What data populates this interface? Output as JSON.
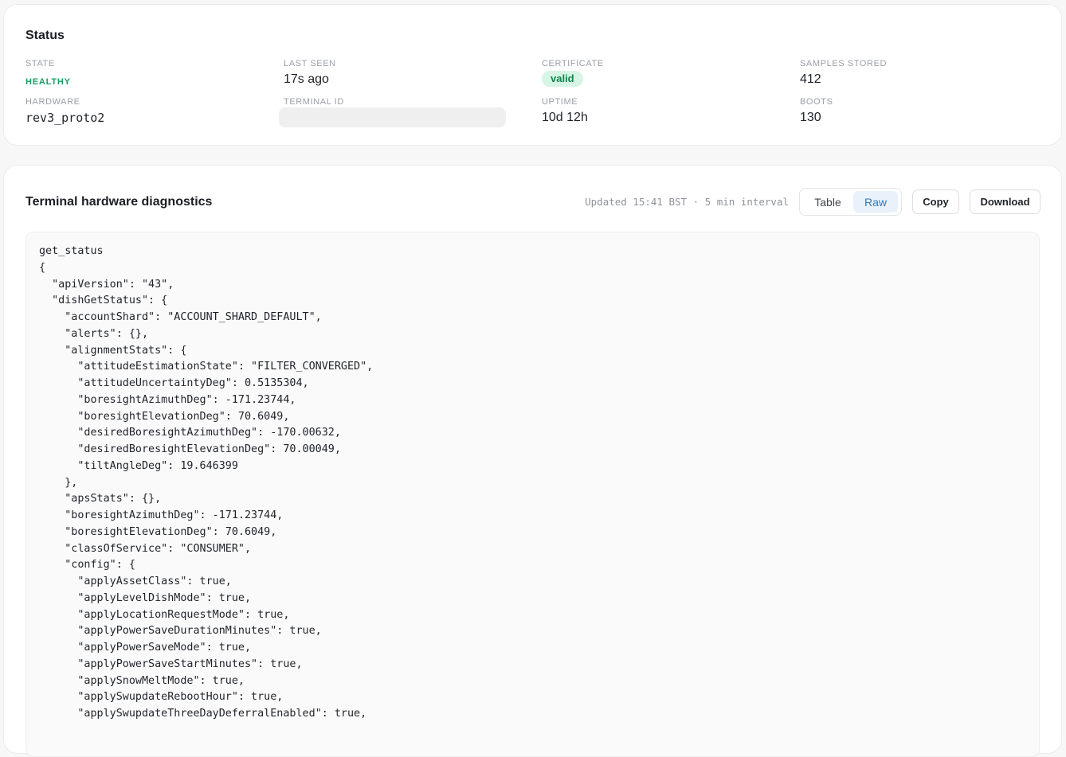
{
  "status": {
    "title": "Status",
    "fields": {
      "state": {
        "label": "STATE",
        "value": "HEALTHY"
      },
      "last_seen": {
        "label": "LAST SEEN",
        "value": "17s ago"
      },
      "certificate": {
        "label": "CERTIFICATE",
        "value": "valid"
      },
      "samples_stored": {
        "label": "SAMPLES STORED",
        "value": "412"
      },
      "hardware": {
        "label": "HARDWARE",
        "value": "rev3_proto2"
      },
      "terminal_id": {
        "label": "TERMINAL ID",
        "value": ""
      },
      "uptime": {
        "label": "UPTIME",
        "value": "10d 12h"
      },
      "boots": {
        "label": "BOOTS",
        "value": "130"
      }
    }
  },
  "diagnostics": {
    "title": "Terminal hardware diagnostics",
    "updated": "Updated 15:41 BST · 5 min interval",
    "view_toggle": {
      "table_label": "Table",
      "raw_label": "Raw",
      "selected": "Raw"
    },
    "copy_label": "Copy",
    "download_label": "Download",
    "raw_lines": [
      "get_status",
      "{",
      "  \"apiVersion\": \"43\",",
      "  \"dishGetStatus\": {",
      "    \"accountShard\": \"ACCOUNT_SHARD_DEFAULT\",",
      "    \"alerts\": {},",
      "    \"alignmentStats\": {",
      "      \"attitudeEstimationState\": \"FILTER_CONVERGED\",",
      "      \"attitudeUncertaintyDeg\": 0.5135304,",
      "      \"boresightAzimuthDeg\": -171.23744,",
      "      \"boresightElevationDeg\": 70.6049,",
      "      \"desiredBoresightAzimuthDeg\": -170.00632,",
      "      \"desiredBoresightElevationDeg\": 70.00049,",
      "      \"tiltAngleDeg\": 19.646399",
      "    },",
      "    \"apsStats\": {},",
      "    \"boresightAzimuthDeg\": -171.23744,",
      "    \"boresightElevationDeg\": 70.6049,",
      "    \"classOfService\": \"CONSUMER\",",
      "    \"config\": {",
      "      \"applyAssetClass\": true,",
      "      \"applyLevelDishMode\": true,",
      "      \"applyLocationRequestMode\": true,",
      "      \"applyPowerSaveDurationMinutes\": true,",
      "      \"applyPowerSaveMode\": true,",
      "      \"applyPowerSaveStartMinutes\": true,",
      "      \"applySnowMeltMode\": true,",
      "      \"applySwupdateRebootHour\": true,",
      "      \"applySwupdateThreeDayDeferralEnabled\": true,"
    ]
  }
}
